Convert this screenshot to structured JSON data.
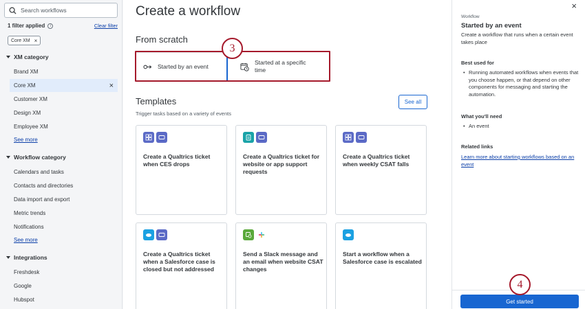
{
  "sidebar": {
    "search_placeholder": "Search workflows",
    "filters_applied": "1 filter applied",
    "clear_filter": "Clear filter",
    "chip": "Core XM",
    "xm_category": {
      "title": "XM category",
      "items": [
        "Brand XM",
        "Core XM",
        "Customer XM",
        "Design XM",
        "Employee XM"
      ],
      "selected": "Core XM",
      "see_more": "See more"
    },
    "workflow_category": {
      "title": "Workflow category",
      "items": [
        "Calendars and tasks",
        "Contacts and directories",
        "Data import and export",
        "Metric trends",
        "Notifications"
      ],
      "see_more": "See more"
    },
    "integrations": {
      "title": "Integrations",
      "items": [
        "Freshdesk",
        "Google",
        "Hubspot"
      ]
    }
  },
  "main": {
    "title": "Create a workflow",
    "from_scratch": "From scratch",
    "option_event": "Started by an event",
    "option_time": "Started at a specific time",
    "step_3": "3",
    "templates_title": "Templates",
    "templates_sub": "Trigger tasks based on a variety of events",
    "see_all": "See all",
    "cards": [
      {
        "title": "Create a Qualtrics ticket when CES drops",
        "icons": [
          "survey-icon",
          "ticket-icon"
        ]
      },
      {
        "title": "Create a Qualtrics ticket for website or app support requests",
        "icons": [
          "clipboard-icon",
          "ticket-icon"
        ]
      },
      {
        "title": "Create a Qualtrics ticket when weekly CSAT falls",
        "icons": [
          "survey-icon",
          "ticket-icon"
        ]
      },
      {
        "title": "Create a Qualtrics ticket when a Salesforce case is closed but not addressed",
        "icons": [
          "salesforce-icon",
          "ticket-icon"
        ]
      },
      {
        "title": "Send a Slack message and an email when website CSAT changes",
        "icons": [
          "schedule-icon",
          "slack-icon"
        ]
      },
      {
        "title": "Start a workflow when a Salesforce case is escalated",
        "icons": [
          "salesforce-icon"
        ]
      }
    ]
  },
  "panel": {
    "eyebrow": "Workflow",
    "title": "Started by an event",
    "description": "Create a workflow that runs when a certain event takes place",
    "best_used_for": "Best used for",
    "best_used_items": [
      "Running automated workflows when events that you choose happen, or that depend on other components for messaging and starting the automation."
    ],
    "what_youll_need": "What you'll need",
    "need_items": [
      "An event"
    ],
    "related_links": "Related links",
    "link_text": "Learn more about starting workflows based on an event",
    "get_started": "Get started",
    "step_4": "4"
  },
  "colors": {
    "accent": "#1866d1",
    "highlight": "#a5192b",
    "icon_purple": "#5b6ac6",
    "icon_teal": "#1aa3a8",
    "salesforce": "#1ba1e2",
    "schedule_green": "#5aa93b"
  }
}
